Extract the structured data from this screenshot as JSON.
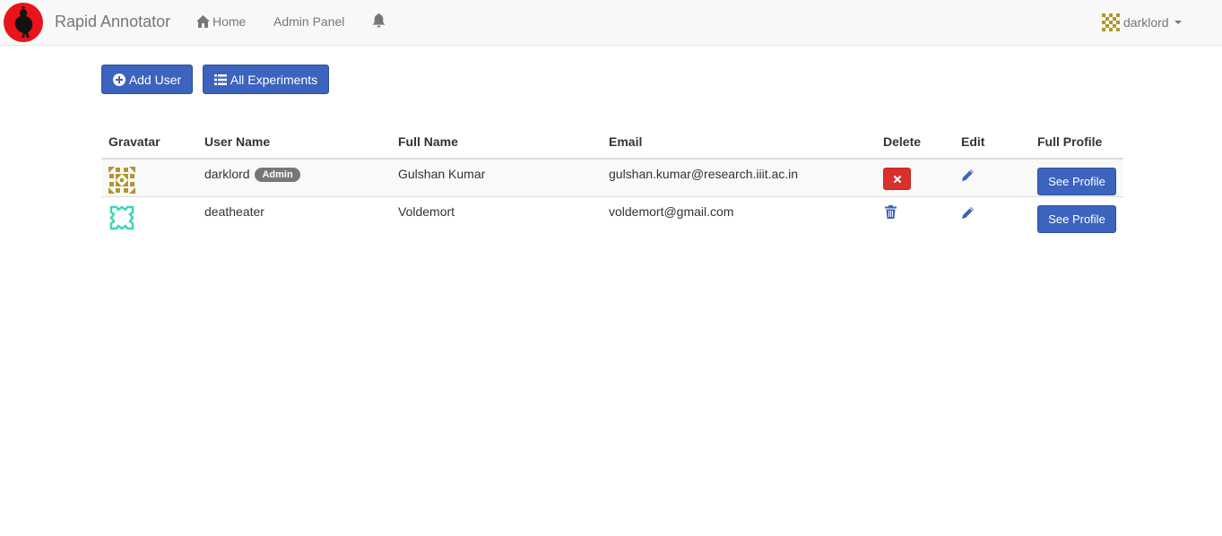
{
  "navbar": {
    "brand": "Rapid Annotator",
    "home_label": "Home",
    "admin_label": "Admin Panel",
    "username": "darklord"
  },
  "toolbar": {
    "add_user_label": "Add User",
    "all_experiments_label": "All Experiments"
  },
  "table": {
    "headers": [
      "Gravatar",
      "User Name",
      "Full Name",
      "Email",
      "Delete",
      "Edit",
      "Full Profile"
    ],
    "rows": [
      {
        "username": "darklord",
        "badge": "Admin",
        "full_name": "Gulshan Kumar",
        "email": "gulshan.kumar@research.iiit.ac.in",
        "delete_style": "button",
        "profile_label": "See Profile",
        "gravatar_color": "#b0962c"
      },
      {
        "username": "deatheater",
        "badge": "",
        "full_name": "Voldemort",
        "email": "voldemort@gmail.com",
        "delete_style": "trash-icon",
        "profile_label": "See Profile",
        "gravatar_color": "#3ed6b5"
      }
    ]
  },
  "colors": {
    "primary": "#3c63bd",
    "danger": "#d9302c",
    "navbar_bg": "#f8f8f8",
    "link": "#3c63bd"
  }
}
